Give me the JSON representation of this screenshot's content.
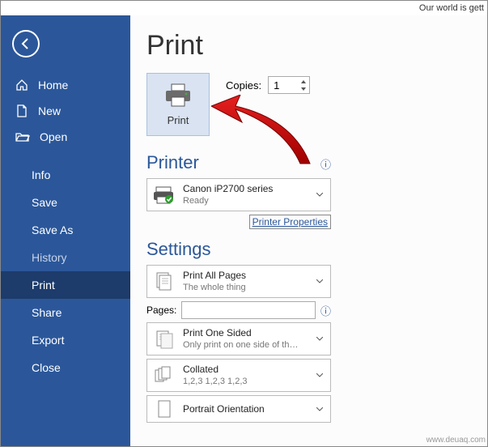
{
  "window": {
    "title_fragment": "Our world is gett"
  },
  "sidebar": {
    "home": "Home",
    "new": "New",
    "open": "Open",
    "info": "Info",
    "save": "Save",
    "save_as": "Save As",
    "history": "History",
    "print": "Print",
    "share": "Share",
    "export": "Export",
    "close": "Close"
  },
  "main": {
    "title": "Print",
    "print_button": "Print",
    "copies_label": "Copies:",
    "copies_value": "1",
    "printer_heading": "Printer",
    "printer_name": "Canon iP2700 series",
    "printer_status": "Ready",
    "printer_properties": "Printer Properties",
    "settings_heading": "Settings",
    "pages_label": "Pages:",
    "dd_all_pages": {
      "l1": "Print All Pages",
      "l2": "The whole thing"
    },
    "dd_one_sided": {
      "l1": "Print One Sided",
      "l2": "Only print on one side of th…"
    },
    "dd_collated": {
      "l1": "Collated",
      "l2": "1,2,3    1,2,3    1,2,3"
    },
    "dd_orientation": {
      "l1": "Portrait Orientation"
    }
  },
  "watermark": "www.deuaq.com"
}
